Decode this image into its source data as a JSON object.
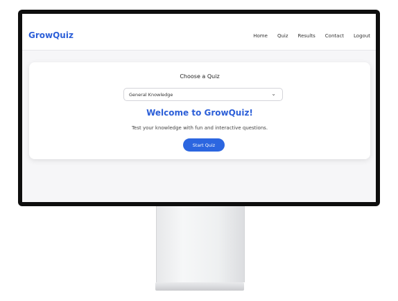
{
  "app": {
    "brand": "GrowQuiz"
  },
  "nav": {
    "links": [
      "Home",
      "Quiz",
      "Results",
      "Contact",
      "Logout"
    ]
  },
  "quiz": {
    "choose_title": "Choose a Quiz",
    "selected_category": "General Knowledge",
    "welcome": "Welcome to GrowQuiz!",
    "subtitle": "Test your knowledge with fun and interactive questions.",
    "start_label": "Start Quiz"
  },
  "icons": {
    "select_arrow": "chevron-down-icon"
  },
  "colors": {
    "accent": "#2c66e0",
    "brand": "#2c5fd8"
  }
}
